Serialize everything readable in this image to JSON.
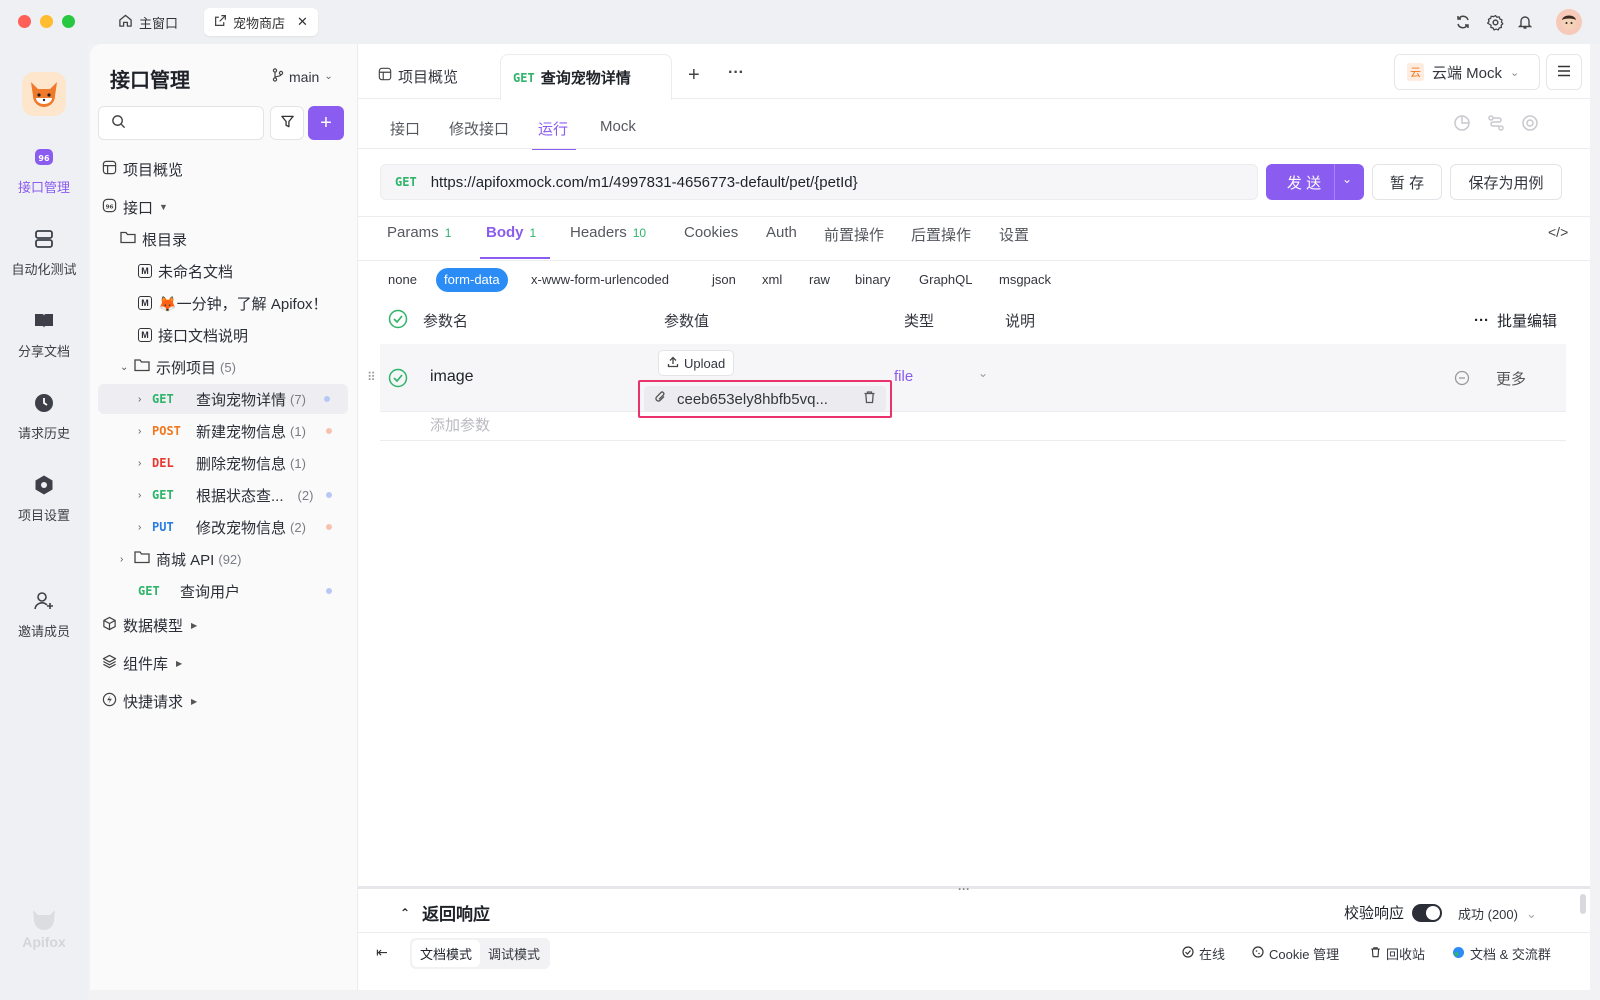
{
  "window_tabs": [
    {
      "label": "主窗口"
    },
    {
      "label": "宠物商店"
    }
  ],
  "app_name": "Apifox",
  "left_nav": [
    {
      "label": "接口管理",
      "icon": "api-icon",
      "active": true
    },
    {
      "label": "自动化测试",
      "icon": "stack-icon"
    },
    {
      "label": "分享文档",
      "icon": "book-icon"
    },
    {
      "label": "请求历史",
      "icon": "clock-icon"
    },
    {
      "label": "项目设置",
      "icon": "settings-icon"
    },
    {
      "label": "邀请成员",
      "icon": "add-user-icon"
    }
  ],
  "sidebar": {
    "title": "接口管理",
    "branch": "main",
    "search_placeholder": "",
    "overview": "项目概览",
    "api_root": "接口",
    "root_dir": "根目录",
    "docs": [
      "未命名文档",
      "🦊一分钟，了解 Apifox！",
      "接口文档说明"
    ],
    "folder": {
      "name": "示例项目",
      "count": "(5)"
    },
    "endpoints": [
      {
        "method": "GET",
        "name": "查询宠物详情",
        "count": "(7)",
        "color": "#2fb46a",
        "dot": "#b8c8f5",
        "selected": true
      },
      {
        "method": "POST",
        "name": "新建宠物信息",
        "count": "(1)",
        "color": "#f0781e",
        "dot": "#f6c2b0"
      },
      {
        "method": "DEL",
        "name": "删除宠物信息",
        "count": "(1)",
        "color": "#e8382f",
        "dot": ""
      },
      {
        "method": "GET",
        "name": "根据状态查...",
        "count": "(2)",
        "color": "#2fb46a",
        "dot": "#b8c8f5"
      },
      {
        "method": "PUT",
        "name": "修改宠物信息",
        "count": "(2)",
        "color": "#2a7ee0",
        "dot": "#f6c2b0"
      }
    ],
    "shop_folder": {
      "name": "商城 API",
      "count": "(92)"
    },
    "user_endpoint": {
      "method": "GET",
      "name": "查询用户"
    },
    "sections": [
      "数据模型",
      "组件库",
      "快捷请求"
    ]
  },
  "tabs": {
    "overview": "项目概览",
    "active_method": "GET",
    "active_name": "查询宠物详情"
  },
  "env": {
    "badge": "云",
    "label": "云端 Mock"
  },
  "subtabs": [
    "接口",
    "修改接口",
    "运行",
    "Mock"
  ],
  "request": {
    "method": "GET",
    "url": "https://apifoxmock.com/m1/4997831-4656773-default/pet/{petId}"
  },
  "buttons": {
    "send": "发 送",
    "save": "暂 存",
    "save_case": "保存为用例"
  },
  "body_tabs": [
    {
      "label": "Params",
      "count": "1"
    },
    {
      "label": "Body",
      "count": "1"
    },
    {
      "label": "Headers",
      "count": "10"
    },
    {
      "label": "Cookies",
      "count": ""
    },
    {
      "label": "Auth",
      "count": ""
    },
    {
      "label": "前置操作",
      "count": ""
    },
    {
      "label": "后置操作",
      "count": ""
    },
    {
      "label": "设置",
      "count": ""
    }
  ],
  "body_types": [
    "none",
    "form-data",
    "x-www-form-urlencoded",
    "json",
    "xml",
    "raw",
    "binary",
    "GraphQL",
    "msgpack"
  ],
  "table": {
    "headers": {
      "name": "参数名",
      "value": "参数值",
      "type": "类型",
      "desc": "说明"
    },
    "bulk_edit": "批量编辑",
    "row": {
      "name": "image",
      "upload": "Upload",
      "file": "ceeb653ely8hbfb5vq...",
      "type": "file",
      "more": "更多"
    },
    "add_param": "添加参数"
  },
  "response": {
    "title": "返回响应",
    "validate": "校验响应",
    "status": "成功 (200)"
  },
  "footer": {
    "doc_mode": "文档模式",
    "debug_mode": "调试模式",
    "online": "在线",
    "cookie": "Cookie 管理",
    "trash": "回收站",
    "community": "文档 & 交流群"
  }
}
